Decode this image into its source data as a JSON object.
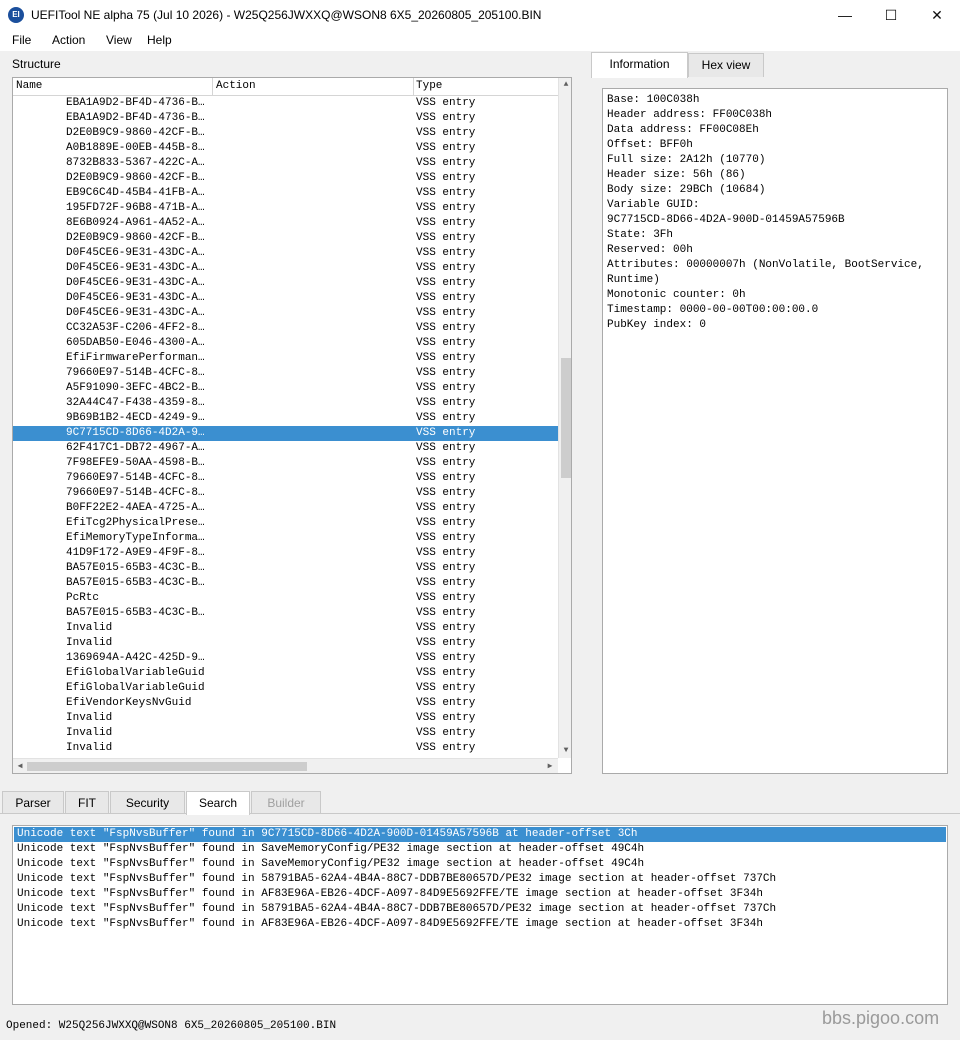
{
  "window": {
    "title": "UEFITool NE alpha 75 (Jul 10 2026) - W25Q256JWXXQ@WSON8 6X5_20260805_205100.BIN",
    "icon_label": "EI",
    "minimize": "—",
    "maximize": "☐",
    "close": "✕"
  },
  "menu": [
    "File",
    "Action",
    "View",
    "Help"
  ],
  "structure": {
    "label": "Structure",
    "columns": [
      "Name",
      "Action",
      "Type"
    ],
    "rows": [
      {
        "name": "EBA1A9D2-BF4D-4736-B…",
        "type": "VSS entry"
      },
      {
        "name": "EBA1A9D2-BF4D-4736-B…",
        "type": "VSS entry"
      },
      {
        "name": "D2E0B9C9-9860-42CF-B…",
        "type": "VSS entry"
      },
      {
        "name": "A0B1889E-00EB-445B-8…",
        "type": "VSS entry"
      },
      {
        "name": "8732B833-5367-422C-A…",
        "type": "VSS entry"
      },
      {
        "name": "D2E0B9C9-9860-42CF-B…",
        "type": "VSS entry"
      },
      {
        "name": "EB9C6C4D-45B4-41FB-A…",
        "type": "VSS entry"
      },
      {
        "name": "195FD72F-96B8-471B-A…",
        "type": "VSS entry"
      },
      {
        "name": "8E6B0924-A961-4A52-A…",
        "type": "VSS entry"
      },
      {
        "name": "D2E0B9C9-9860-42CF-B…",
        "type": "VSS entry"
      },
      {
        "name": "D0F45CE6-9E31-43DC-A…",
        "type": "VSS entry"
      },
      {
        "name": "D0F45CE6-9E31-43DC-A…",
        "type": "VSS entry"
      },
      {
        "name": "D0F45CE6-9E31-43DC-A…",
        "type": "VSS entry"
      },
      {
        "name": "D0F45CE6-9E31-43DC-A…",
        "type": "VSS entry"
      },
      {
        "name": "D0F45CE6-9E31-43DC-A…",
        "type": "VSS entry"
      },
      {
        "name": "CC32A53F-C206-4FF2-8…",
        "type": "VSS entry"
      },
      {
        "name": "605DAB50-E046-4300-A…",
        "type": "VSS entry"
      },
      {
        "name": "EfiFirmwarePerforman…",
        "type": "VSS entry"
      },
      {
        "name": "79660E97-514B-4CFC-8…",
        "type": "VSS entry"
      },
      {
        "name": "A5F91090-3EFC-4BC2-B…",
        "type": "VSS entry"
      },
      {
        "name": "32A44C47-F438-4359-8…",
        "type": "VSS entry"
      },
      {
        "name": "9B69B1B2-4ECD-4249-9…",
        "type": "VSS entry"
      },
      {
        "name": "9C7715CD-8D66-4D2A-9…",
        "type": "VSS entry",
        "selected": true
      },
      {
        "name": "62F417C1-DB72-4967-A…",
        "type": "VSS entry"
      },
      {
        "name": "7F98EFE9-50AA-4598-B…",
        "type": "VSS entry"
      },
      {
        "name": "79660E97-514B-4CFC-8…",
        "type": "VSS entry"
      },
      {
        "name": "79660E97-514B-4CFC-8…",
        "type": "VSS entry"
      },
      {
        "name": "B0FF22E2-4AEA-4725-A…",
        "type": "VSS entry"
      },
      {
        "name": "EfiTcg2PhysicalPrese…",
        "type": "VSS entry"
      },
      {
        "name": "EfiMemoryTypeInforma…",
        "type": "VSS entry"
      },
      {
        "name": "41D9F172-A9E9-4F9F-8…",
        "type": "VSS entry"
      },
      {
        "name": "BA57E015-65B3-4C3C-B…",
        "type": "VSS entry"
      },
      {
        "name": "BA57E015-65B3-4C3C-B…",
        "type": "VSS entry"
      },
      {
        "name": "PcRtc",
        "type": "VSS entry"
      },
      {
        "name": "BA57E015-65B3-4C3C-B…",
        "type": "VSS entry"
      },
      {
        "name": "Invalid",
        "type": "VSS entry"
      },
      {
        "name": "Invalid",
        "type": "VSS entry"
      },
      {
        "name": "1369694A-A42C-425D-9…",
        "type": "VSS entry"
      },
      {
        "name": "EfiGlobalVariableGuid",
        "type": "VSS entry"
      },
      {
        "name": "EfiGlobalVariableGuid",
        "type": "VSS entry"
      },
      {
        "name": "EfiVendorKeysNvGuid",
        "type": "VSS entry"
      },
      {
        "name": "Invalid",
        "type": "VSS entry"
      },
      {
        "name": "Invalid",
        "type": "VSS entry"
      },
      {
        "name": "Invalid",
        "type": "VSS entry"
      }
    ]
  },
  "info_tabs": [
    "Information",
    "Hex view"
  ],
  "information": [
    "Base: 100C038h",
    "Header address: FF00C038h",
    "Data address: FF00C08Eh",
    "Offset: BFF0h",
    "Full size: 2A12h (10770)",
    "Header size: 56h (86)",
    "Body size: 29BCh (10684)",
    "Variable GUID:",
    "9C7715CD-8D66-4D2A-900D-01459A57596B",
    "State: 3Fh",
    "Reserved: 00h",
    "Attributes: 00000007h (NonVolatile, BootService,",
    "Runtime)",
    "Monotonic counter: 0h",
    "Timestamp: 0000-00-00T00:00:00.0",
    "PubKey index: 0"
  ],
  "bottom_tabs": [
    "Parser",
    "FIT",
    "Security",
    "Search",
    "Builder"
  ],
  "search_results": [
    "Unicode text \"FspNvsBuffer\" found in 9C7715CD-8D66-4D2A-900D-01459A57596B at header-offset 3Ch",
    "Unicode text \"FspNvsBuffer\" found in SaveMemoryConfig/PE32 image section at header-offset 49C4h",
    "Unicode text \"FspNvsBuffer\" found in SaveMemoryConfig/PE32 image section at header-offset 49C4h",
    "Unicode text \"FspNvsBuffer\" found in 58791BA5-62A4-4B4A-88C7-DDB7BE80657D/PE32 image section at header-offset 737Ch",
    "Unicode text \"FspNvsBuffer\" found in AF83E96A-EB26-4DCF-A097-84D9E5692FFE/TE image section at header-offset 3F34h",
    "Unicode text \"FspNvsBuffer\" found in 58791BA5-62A4-4B4A-88C7-DDB7BE80657D/PE32 image section at header-offset 737Ch",
    "Unicode text \"FspNvsBuffer\" found in AF83E96A-EB26-4DCF-A097-84D9E5692FFE/TE image section at header-offset 3F34h"
  ],
  "status": "Opened: W25Q256JWXXQ@WSON8 6X5_20260805_205100.BIN",
  "watermark": "bbs.pigoo.com",
  "colors": {
    "selection": "#3b8fd0",
    "window_bg": "#f0f0f0"
  }
}
